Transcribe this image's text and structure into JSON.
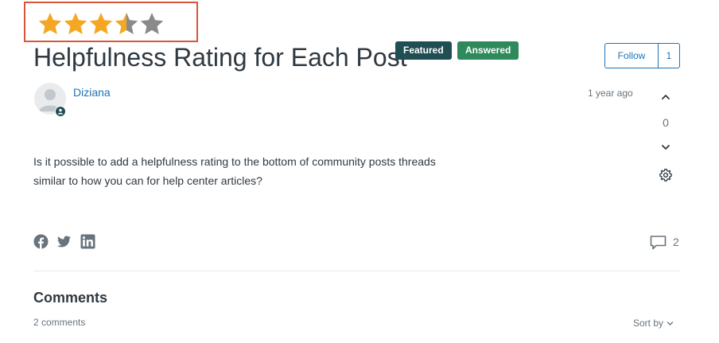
{
  "rating": {
    "value": 3.5,
    "max": 5,
    "filled_color": "#f5a623",
    "empty_color": "#8a8a8a",
    "highlight_border_color": "#d9553a"
  },
  "post": {
    "title": "Helpfulness Rating for Each Post",
    "badges": {
      "featured": "Featured",
      "answered": "Answered"
    },
    "follow": {
      "label": "Follow",
      "count": "1"
    },
    "author": "Diziana",
    "timestamp": "1 year ago",
    "votes": "0",
    "body": "Is it possible to add a helpfulness rating to the bottom of community posts threads similar to how you can for help center articles?",
    "comment_count": "2"
  },
  "comments": {
    "heading": "Comments",
    "count_label": "2 comments",
    "sort_label": "Sort by"
  },
  "icons": {
    "avatar": "user-avatar-icon",
    "avatar_badge": "user-badge-icon",
    "vote_up": "chevron-up-icon",
    "vote_down": "chevron-down-icon",
    "settings": "gear-icon",
    "facebook": "facebook-icon",
    "twitter": "twitter-icon",
    "linkedin": "linkedin-icon",
    "comments": "speech-bubble-icon",
    "sort": "chevron-down-icon"
  },
  "colors": {
    "link": "#1f73b7",
    "featured_badge": "#1f4e53",
    "answered_badge": "#2e8a5a",
    "text": "#2f3941",
    "muted": "#68737d"
  }
}
